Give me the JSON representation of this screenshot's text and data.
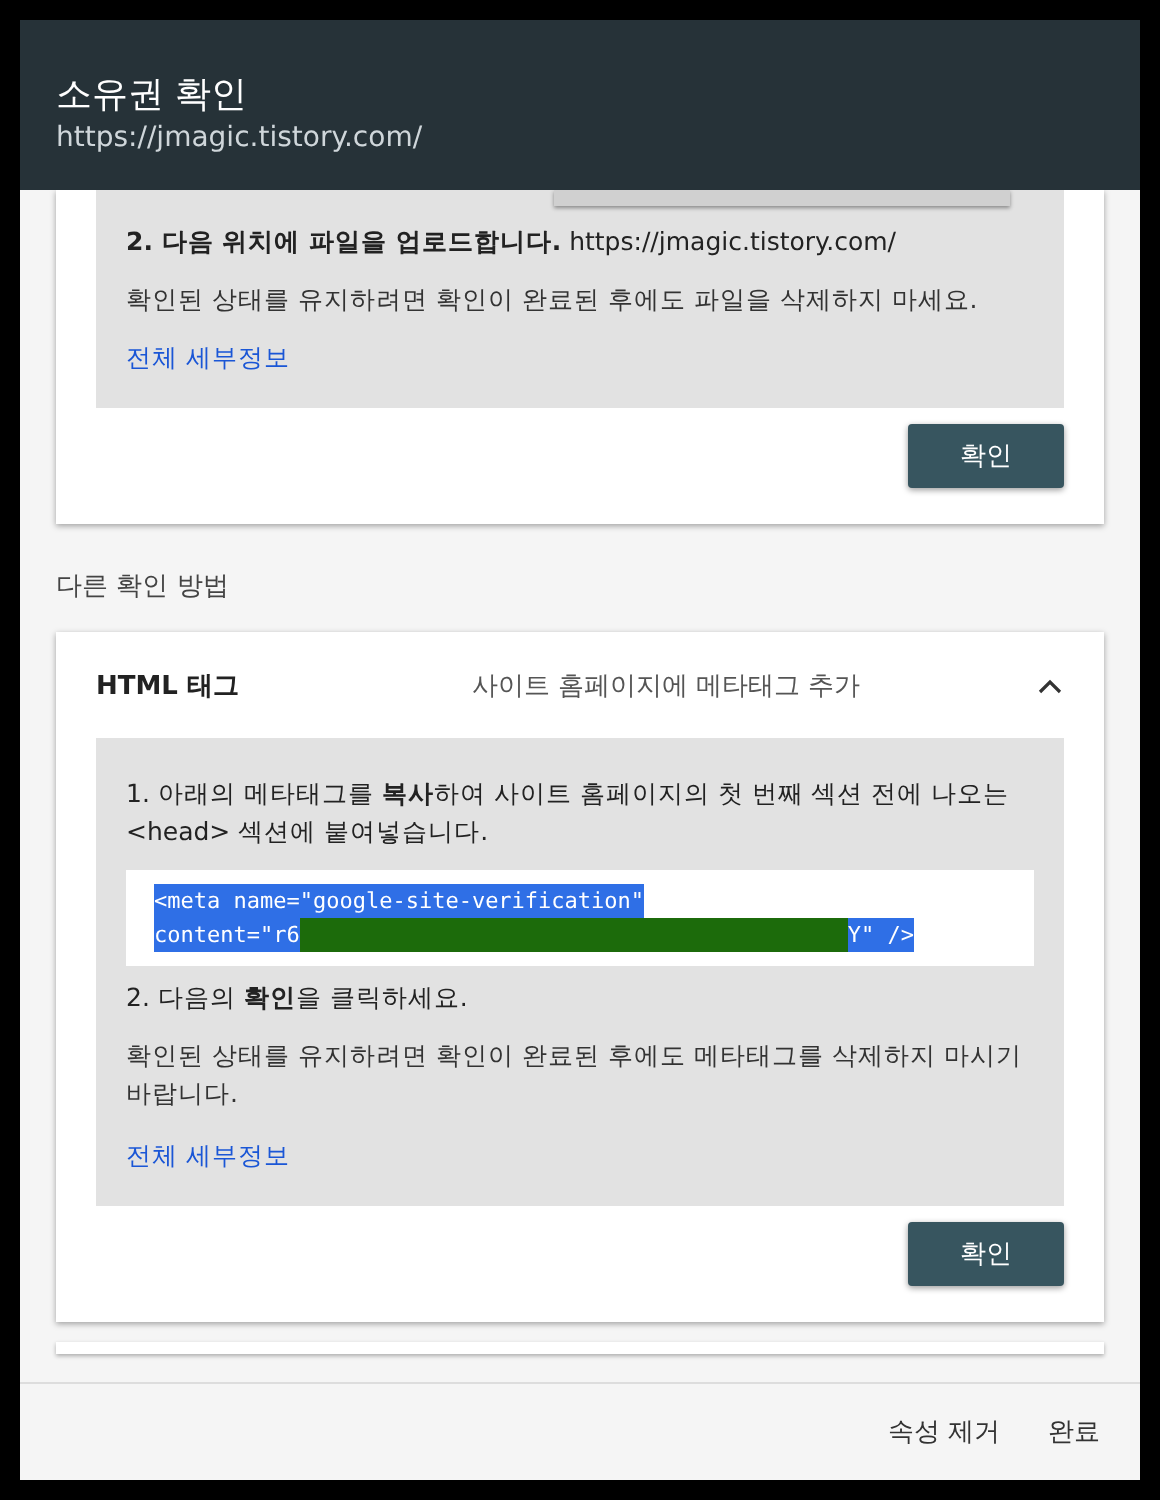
{
  "dialog": {
    "title": "소유권 확인",
    "subtitle": "https://jmagic.tistory.com/"
  },
  "top_card": {
    "step_2": "**2. 다음 위치에 파일을 업로드합니다.** https://jmagic.tistory.com/",
    "note": "확인된 상태를 유지하려면 확인이 완료된 후에도 파일을 삭제하지 마세요.",
    "details_link": "전체 세부정보",
    "confirm_button": "확인"
  },
  "other_methods_heading": "다른 확인 방법",
  "html_tag_card": {
    "name": "HTML 태그",
    "description": "사이트 홈페이지에 메타태그 추가",
    "expanded": true,
    "step_1": "1. 아래의 메타태그를 **복사**하여 사이트 홈페이지의 첫 번째 섹션 전에 나오는 <head> 섹션에 붙여넣습니다.",
    "code_line_1": "<meta name=\"google-site-verification\"",
    "code_line_2_start": "content=\"r6",
    "code_line_2_end": "Y\" />",
    "step_2": "2. 다음의 **확인**을 클릭하세요.",
    "note": "확인된 상태를 유지하려면 확인이 완료된 후에도 메타태그를 삭제하지 마시기 바랍니다.",
    "details_link": "전체 세부정보",
    "confirm_button": "확인"
  },
  "footer_buttons": [
    {
      "label": "속성 제거"
    },
    {
      "label": "완료"
    }
  ]
}
